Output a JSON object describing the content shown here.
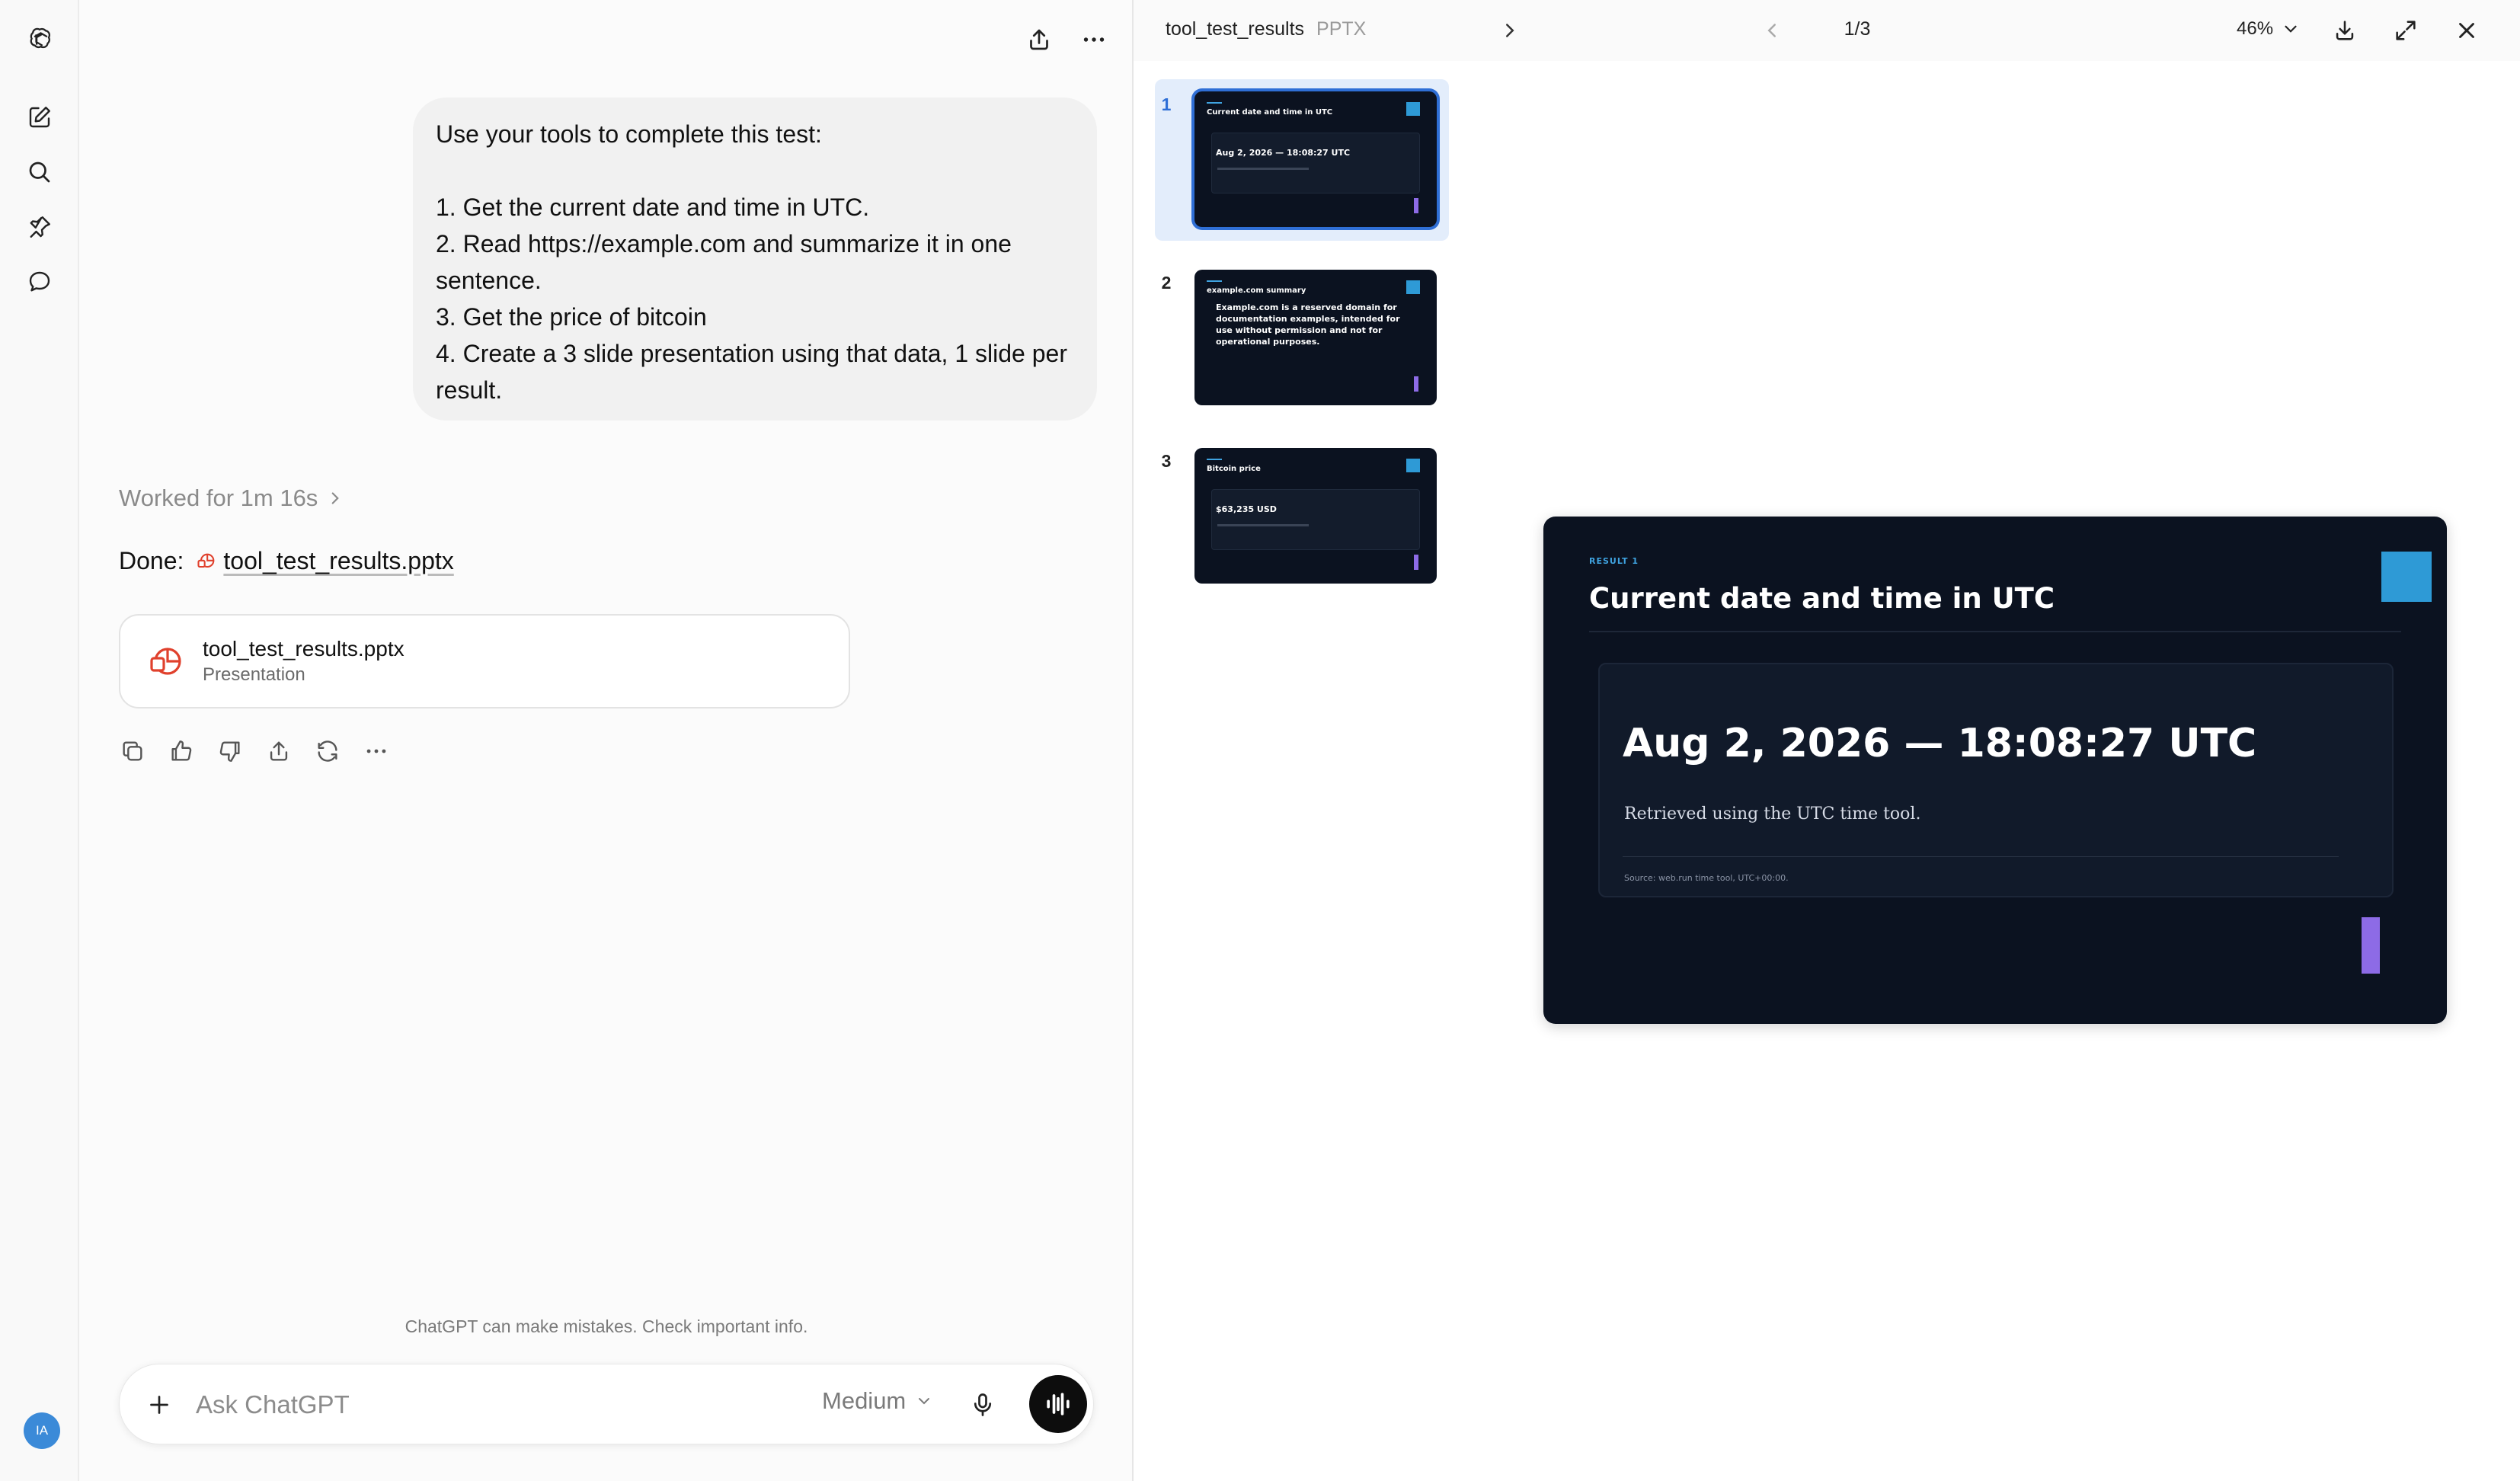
{
  "colors": {
    "accent": "#2f6fd6",
    "slide_bg": "#0b1220",
    "slide_square": "#2e9ad6",
    "slide_bar": "#8d6be6",
    "pptx_icon": "#e0412d"
  },
  "rail": {
    "icons": [
      "openai-logo-icon",
      "new-chat-icon",
      "search-icon",
      "pin-icon",
      "chat-bubble-icon"
    ],
    "avatar_initials": "IA"
  },
  "chat": {
    "user_message": "Use your tools to complete this test:\n\n1. Get the current date and time in UTC.\n2. Read https://example.com and summarize it in one sentence.\n3. Get the price of bitcoin\n4. Create a 3 slide presentation using that data, 1 slide per result.",
    "worked_label": "Worked for 1m 16s",
    "done_label": "Done:",
    "done_link": "tool_test_results.pptx",
    "file_card": {
      "name": "tool_test_results.pptx",
      "type": "Presentation"
    },
    "action_icons": [
      "copy-icon",
      "thumbs-up-icon",
      "thumbs-down-icon",
      "share-icon",
      "regenerate-icon",
      "more-icon"
    ],
    "disclaimer": "ChatGPT can make mistakes. Check important info.",
    "composer": {
      "placeholder": "Ask ChatGPT",
      "model": "Medium"
    }
  },
  "preview": {
    "file_name": "tool_test_results",
    "file_ext": "PPTX",
    "page": "1/3",
    "zoom": "46%",
    "current_slide": 1,
    "thumbnails": [
      {
        "num": "1",
        "title": "Current date and time in UTC",
        "main": "Aug 2, 2026 — 18:08:27 UTC"
      },
      {
        "num": "2",
        "title": "example.com summary",
        "body": "Example.com is a reserved domain for documentation examples, intended for use without permission and not for operational purposes."
      },
      {
        "num": "3",
        "title": "Bitcoin price",
        "main": "$63,235 USD"
      }
    ],
    "slide": {
      "kicker": "RESULT 1",
      "title": "Current date and time in UTC",
      "main": "Aug 2, 2026 — 18:08:27 UTC",
      "body": "Retrieved using the UTC time tool.",
      "source": "Source: web.run time tool, UTC+00:00."
    }
  }
}
